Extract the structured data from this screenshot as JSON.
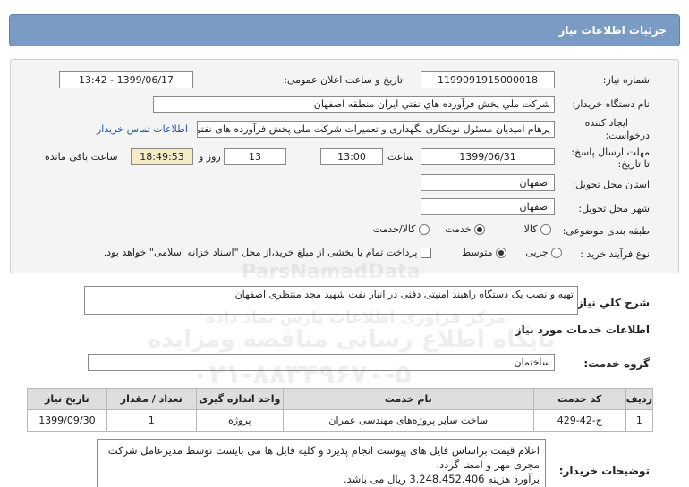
{
  "header": {
    "title": "جزئیات اطلاعات نیاز"
  },
  "fields": {
    "need_number_label": "شماره نیاز:",
    "need_number": "1199091915000018",
    "announce_label": "تاریخ و ساعت اعلان عمومی:",
    "announce_value": "1399/06/17 - 13:42",
    "buyer_label": "نام دستگاه خریدار:",
    "buyer_value": "شرکت ملي پخش فرآورده هاي نفتي ايران منطقه اصفهان",
    "creator_label_1": "ایجاد کننده",
    "creator_label_2": "درخواست:",
    "creator_value": "پرهام امیدیان مسئول نوبتکاری نگهداری و تعمیرات شرکت ملی پخش فرآورده های نفتی ایران منطقه اصفهان",
    "contact_link": "اطلاعات تماس خریدار",
    "deadline_label_1": "مهلت ارسال پاسخ:",
    "deadline_label_2": "تا تاریخ:",
    "deadline_date": "1399/06/31",
    "time_label": "ساعت",
    "deadline_time": "13:00",
    "days_value": "13",
    "days_label": "روز و",
    "remaining_value": "18:49:53",
    "remaining_label": "ساعت باقی مانده",
    "province_label": "استان محل تحویل:",
    "province_value": "اصفهان",
    "city_label": "شهر محل تحویل:",
    "city_value": "اصفهان",
    "category_label": "طبقه بندی موضوعی:",
    "category_options": [
      "کالا",
      "خدمت",
      "کالا/خدمت"
    ],
    "category_selected": "خدمت",
    "process_label": "نوع فرآیند خرید :",
    "process_options": [
      "جزیی",
      "متوسط"
    ],
    "process_selected": "متوسط",
    "payment_note": "پرداخت تمام یا بخشی از مبلغ خرید،از محل \"اسناد خزانه اسلامی\" خواهد بود."
  },
  "summary": {
    "label": "شرح کلي نياز:",
    "value": "تهیه و نصب یک دستگاه راهبند امنیتی دفتی در انبار نفت شهید مجد منتظری اصفهان"
  },
  "services": {
    "section_title": "اطلاعات خدمات مورد نیاز",
    "group_label": "گروه خدمت:",
    "group_value": "ساختمان",
    "columns": [
      "ردیف",
      "کد خدمت",
      "نام خدمت",
      "واحد اندازه گیری",
      "تعداد / مقدار",
      "تاریخ نیاز"
    ],
    "rows": [
      [
        "1",
        "ج-42-429",
        "ساخت سایر پروژه‌های مهندسی عمران",
        "پروژه",
        "1",
        "1399/09/30"
      ]
    ]
  },
  "buyer_notes": {
    "label": "توضیحات خریدار:",
    "lines": [
      "اعلام قیمت براساس فایل های پیوست انجام پذیرد و کلیه فایل ها می بایست توسط مدیرعامل شرکت",
      "مجری مهر و امضا گردد.",
      "برآورد هزینه 3.248.452.406 ریال می باشد."
    ]
  },
  "watermark": {
    "brand": "ParsNamadData",
    "line1": "مرکز فراوری اطلاعات پارس نماد داده",
    "line2": "پایگاه اطلاع رسانی مناقصه ومزایده",
    "phone": "۰۲۱-۸۸۳۴۹۶۷۰-۵"
  }
}
